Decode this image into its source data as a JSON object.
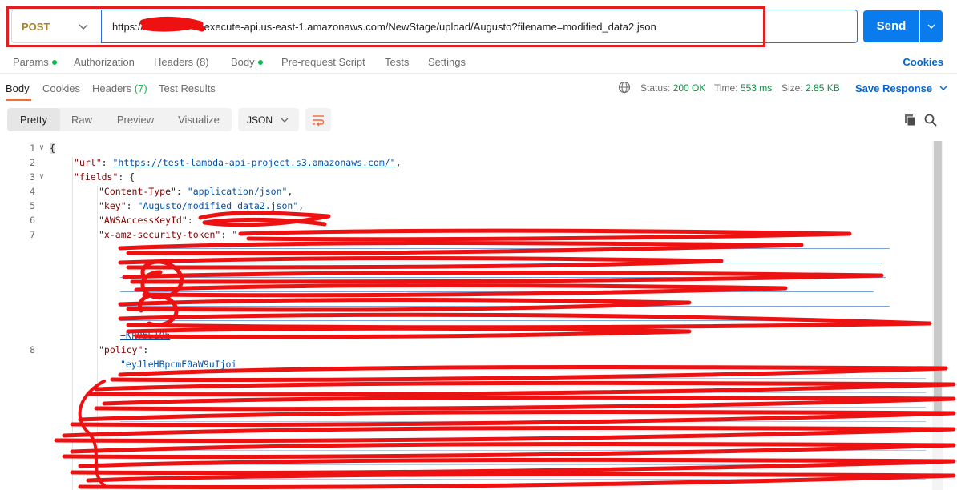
{
  "request": {
    "method": "POST",
    "url_prefix": "https://",
    "url_rest": ".execute-api.us-east-1.amazonaws.com/NewStage/upload/Augusto?filename=modified_data2.json",
    "send_label": "Send"
  },
  "request_tabs": {
    "params": "Params",
    "authorization": "Authorization",
    "headers": "Headers (8)",
    "body": "Body",
    "pre_request": "Pre-request Script",
    "tests": "Tests",
    "settings": "Settings",
    "cookies": "Cookies"
  },
  "response_tabs": {
    "body": "Body",
    "cookies": "Cookies",
    "headers_label": "Headers",
    "headers_count": "(7)",
    "test_results": "Test Results"
  },
  "response_status": {
    "status_label": "Status:",
    "status_value": "200 OK",
    "time_label": "Time:",
    "time_value": "553 ms",
    "size_label": "Size:",
    "size_value": "2.85 KB",
    "save_response": "Save Response"
  },
  "view_modes": {
    "pretty": "Pretty",
    "raw": "Raw",
    "preview": "Preview",
    "visualize": "Visualize",
    "format": "JSON"
  },
  "code_lines": {
    "l1_num": "1",
    "l1": "{",
    "l2_num": "2",
    "l2_key": "\"url\"",
    "l2_val": "\"https://test-lambda-api-project.s3.amazonaws.com/\"",
    "l3_num": "3",
    "l3_key": "\"fields\"",
    "l3_rest": ": {",
    "l4_num": "4",
    "l4_key": "\"Content-Type\"",
    "l4_val": "\"application/json\"",
    "l5_num": "5",
    "l5_key": "\"key\"",
    "l5_val": "\"Augusto/modified_data2.json\"",
    "l6_num": "6",
    "l6_key": "\"AWSAccessKeyId\"",
    "l7_num": "7",
    "l7_key": "\"x-amz-security-token\"",
    "l7_tail": "+Kk0bS10h",
    "l8_num": "8",
    "l8_key": "\"policy\"",
    "l8_val": "\"eyJleHBpcmF0aW9uIjoi"
  },
  "icons": {
    "method_chevron": "chevron-down-icon",
    "send_dropdown": "chevron-down-icon",
    "globe": "globe-icon",
    "wrap": "wrap-lines-icon",
    "copy": "copy-icon",
    "search": "search-icon"
  },
  "colors": {
    "accent": "#097bed",
    "method": "#a9802b",
    "status_ok": "#0c8f43",
    "tab_underline": "#f26b3a",
    "annotation": "#e41e1e"
  }
}
